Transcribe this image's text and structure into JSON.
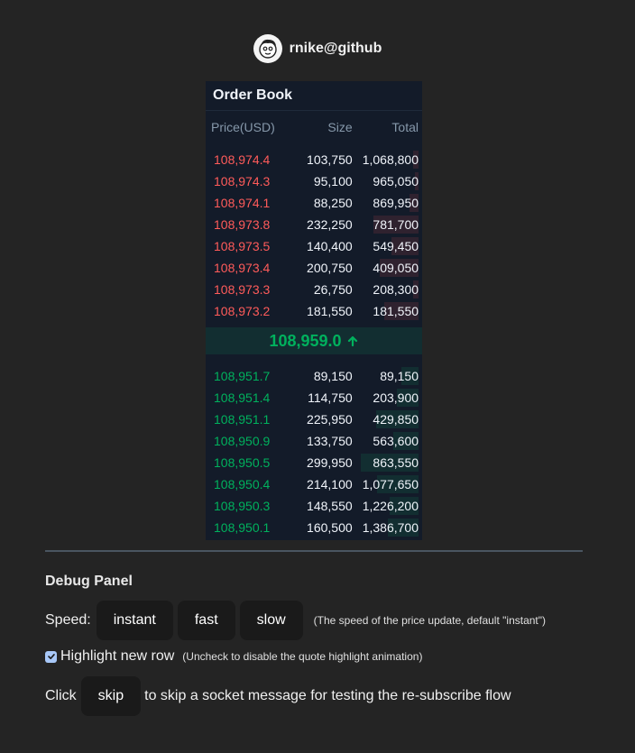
{
  "header": {
    "username": "rnike@github"
  },
  "order_book": {
    "title": "Order Book",
    "columns": {
      "price": "Price(USD)",
      "size": "Size",
      "total": "Total"
    },
    "sells": [
      {
        "price": "108,974.4",
        "size": "103,750",
        "total": "1,068,800",
        "depth": 0.08
      },
      {
        "price": "108,974.3",
        "size": "95,100",
        "total": "965,050",
        "depth": 0.06
      },
      {
        "price": "108,974.1",
        "size": "88,250",
        "total": "869,950",
        "depth": 0.13
      },
      {
        "price": "108,973.8",
        "size": "232,250",
        "total": "781,700",
        "depth": 0.68
      },
      {
        "price": "108,973.5",
        "size": "140,400",
        "total": "549,450",
        "depth": 0.4
      },
      {
        "price": "108,973.4",
        "size": "200,750",
        "total": "409,050",
        "depth": 0.58
      },
      {
        "price": "108,973.3",
        "size": "26,750",
        "total": "208,300",
        "depth": 0.08
      },
      {
        "price": "108,973.2",
        "size": "181,550",
        "total": "181,550",
        "depth": 0.52
      }
    ],
    "mid_price": "108,959.0",
    "buys": [
      {
        "price": "108,951.7",
        "size": "89,150",
        "total": "89,150",
        "depth": 0.26
      },
      {
        "price": "108,951.4",
        "size": "114,750",
        "total": "203,900",
        "depth": 0.33
      },
      {
        "price": "108,951.1",
        "size": "225,950",
        "total": "429,850",
        "depth": 0.64
      },
      {
        "price": "108,950.9",
        "size": "133,750",
        "total": "563,600",
        "depth": 0.38
      },
      {
        "price": "108,950.5",
        "size": "299,950",
        "total": "863,550",
        "depth": 0.86
      },
      {
        "price": "108,950.4",
        "size": "214,100",
        "total": "1,077,650",
        "depth": 0.62
      },
      {
        "price": "108,950.3",
        "size": "148,550",
        "total": "1,226,200",
        "depth": 0.43
      },
      {
        "price": "108,950.1",
        "size": "160,500",
        "total": "1,386,700",
        "depth": 0.46
      }
    ]
  },
  "debug": {
    "title": "Debug Panel",
    "speed_label": "Speed:",
    "speed_buttons": [
      "instant",
      "fast",
      "slow"
    ],
    "speed_note": "(The speed of the price update, default \"instant\")",
    "highlight_label": "Highlight new row",
    "highlight_checked": true,
    "highlight_note": "(Uncheck to disable the quote highlight animation)",
    "click_label": "Click",
    "skip_label": "skip",
    "skip_note": "to skip a socket message for testing the re-subscribe flow"
  },
  "colors": {
    "sell": "#ff5b5a",
    "buy": "#00b15d",
    "panel": "#131b29",
    "background": "#242424"
  },
  "icons": {
    "avatar": "avatar-face-icon",
    "mid_arrow": "arrow-up-icon",
    "checkbox": "checkmark-icon"
  }
}
